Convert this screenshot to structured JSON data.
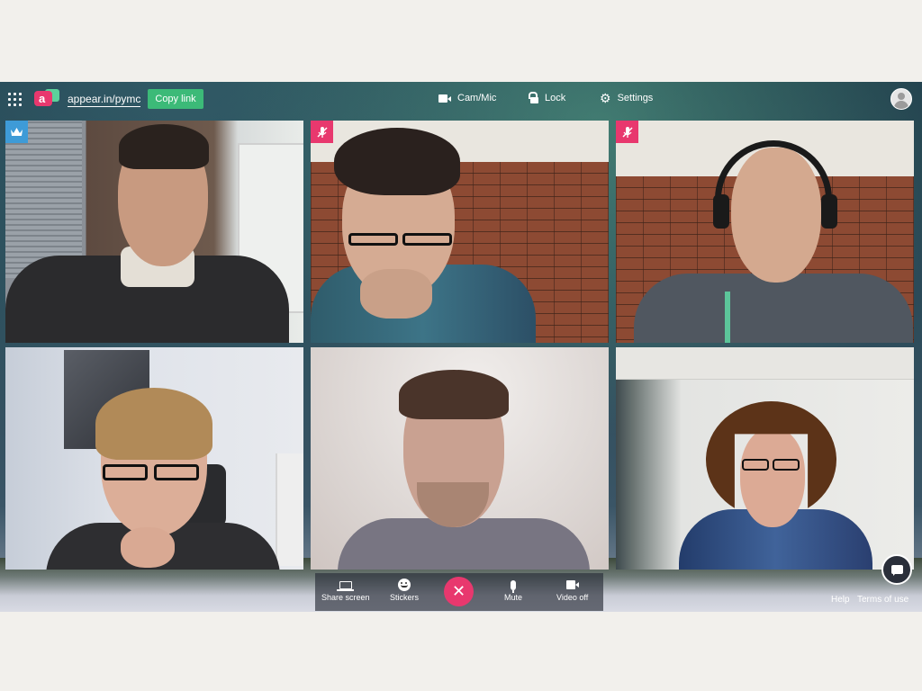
{
  "topbar": {
    "room_name": "appear.in/pymc",
    "copy_link_label": "Copy link",
    "cam_mic_label": "Cam/Mic",
    "lock_label": "Lock",
    "settings_label": "Settings"
  },
  "controls": {
    "share_screen_label": "Share screen",
    "stickers_label": "Stickers",
    "leave_symbol": "✕",
    "mute_label": "Mute",
    "video_off_label": "Video off"
  },
  "footer": {
    "help_label": "Help",
    "terms_label": "Terms of use"
  },
  "participants": [
    {
      "badge": "crown-icon"
    },
    {
      "badge": "mic-muted-icon"
    },
    {
      "badge": "mic-muted-icon"
    },
    {
      "badge": ""
    },
    {
      "badge": ""
    },
    {
      "badge": ""
    }
  ],
  "colors": {
    "brand_pink": "#e8386e",
    "brand_green": "#3cba78",
    "crown_blue": "#3e9bd7"
  }
}
